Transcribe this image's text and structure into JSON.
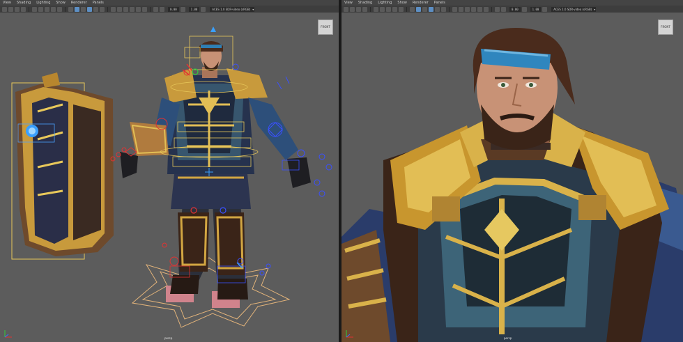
{
  "viewport_menu": [
    "View",
    "Shading",
    "Lighting",
    "Show",
    "Renderer",
    "Panels"
  ],
  "toolbar": {
    "near_clip": "0.00",
    "far_clip": "1.00",
    "color_space": "ACES 1.0 SDR-video (sRGB)"
  },
  "viewcube_label": "FRONT",
  "camera_label": "persp",
  "colors": {
    "viewport_bg": "#5c5c5c",
    "menu_bg": "#444444",
    "gold_trim": "#d9b24a",
    "armor_blue": "#2d4f7a",
    "control_blue": "#3a50ff",
    "control_red": "#e23232"
  }
}
